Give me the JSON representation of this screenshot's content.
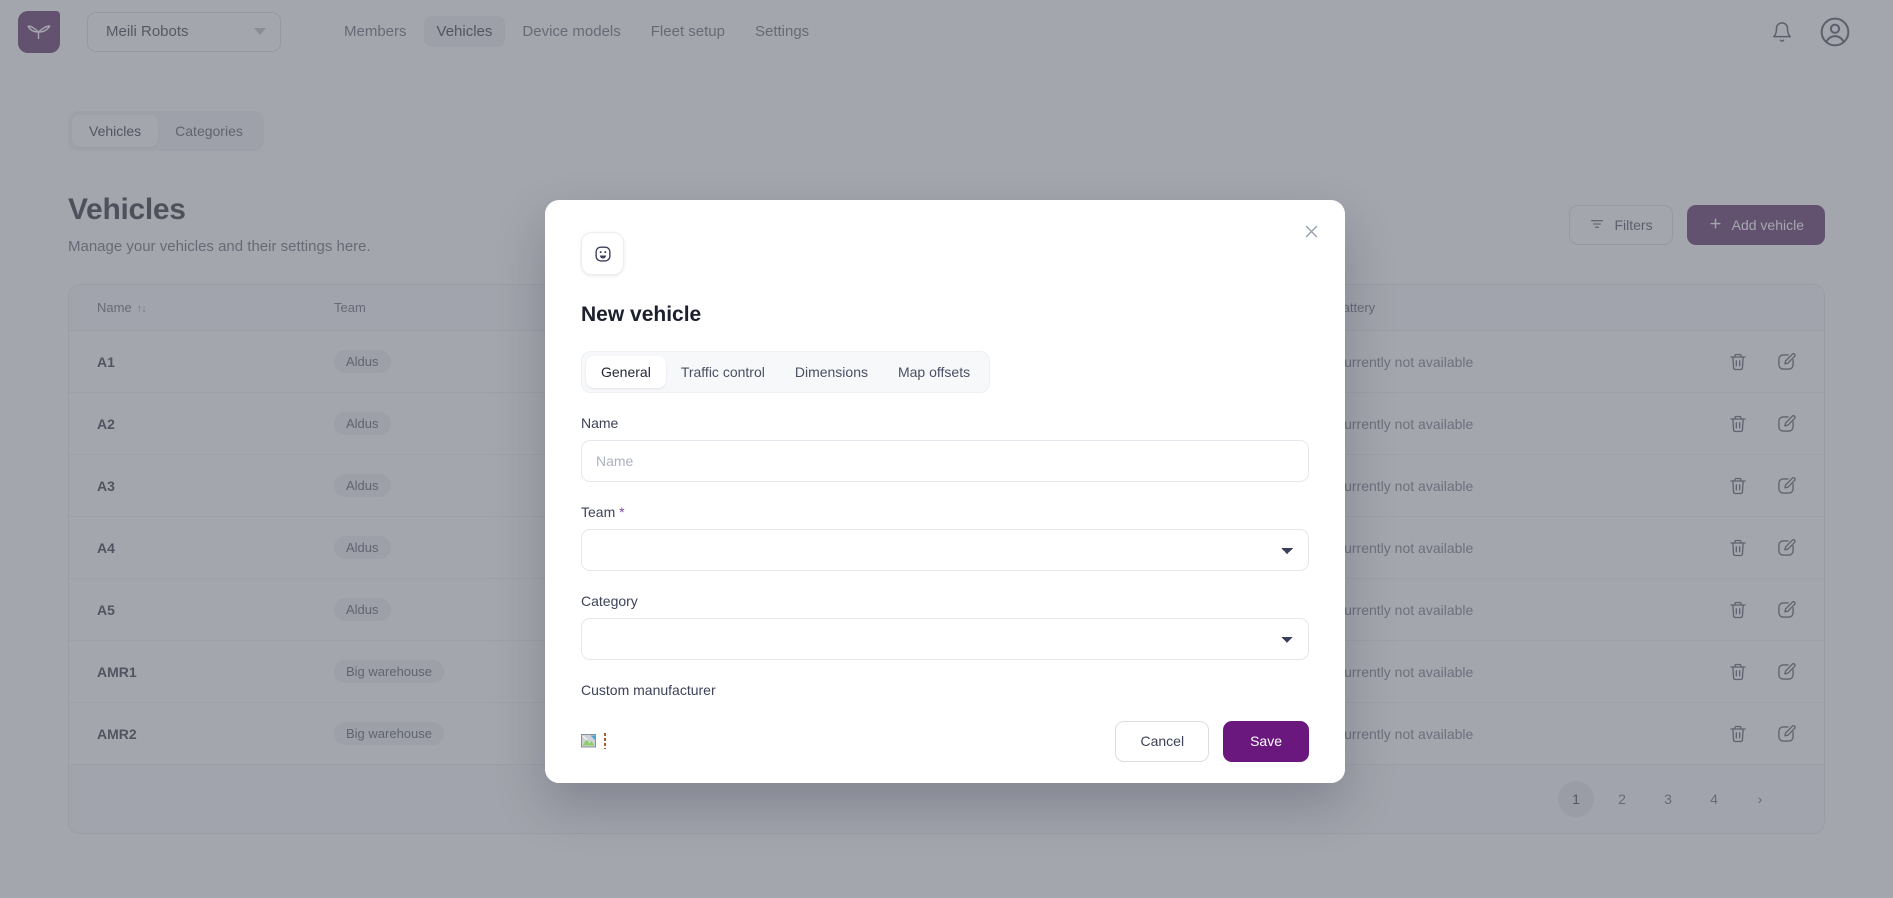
{
  "topnav": {
    "logo_icon": "meili-logo-icon",
    "org": {
      "label": "Meili Robots",
      "caret_icon": "caret-down-icon"
    },
    "links": [
      {
        "label": "Members",
        "active": false
      },
      {
        "label": "Vehicles",
        "active": true
      },
      {
        "label": "Device models",
        "active": false
      },
      {
        "label": "Fleet setup",
        "active": false
      },
      {
        "label": "Settings",
        "active": false
      }
    ],
    "notifications_icon": "bell-icon",
    "account_icon": "user-avatar-icon"
  },
  "section_tabs": [
    {
      "label": "Vehicles",
      "active": true
    },
    {
      "label": "Categories",
      "active": false
    }
  ],
  "page": {
    "title": "Vehicles",
    "subtitle": "Manage your vehicles and their settings here."
  },
  "actions": {
    "filters_label": "Filters",
    "filters_icon": "filter-icon",
    "add_label": "Add vehicle",
    "add_icon": "plus-icon"
  },
  "table": {
    "columns": {
      "name": "Name",
      "name_sort": "↑↓",
      "team": "Team",
      "battery": "Battery"
    },
    "rows": [
      {
        "name": "A1",
        "team": "Aldus",
        "battery": "Currently not available"
      },
      {
        "name": "A2",
        "team": "Aldus",
        "battery": "Currently not available"
      },
      {
        "name": "A3",
        "team": "Aldus",
        "battery": "Currently not available"
      },
      {
        "name": "A4",
        "team": "Aldus",
        "battery": "Currently not available"
      },
      {
        "name": "A5",
        "team": "Aldus",
        "battery": "Currently not available"
      },
      {
        "name": "AMR1",
        "team": "Big warehouse",
        "battery": "Currently not available"
      },
      {
        "name": "AMR2",
        "team": "Big warehouse",
        "battery": "Currently not available"
      }
    ],
    "row_actions": {
      "delete_icon": "trash-icon",
      "edit_icon": "edit-pencil-icon"
    }
  },
  "pagination": {
    "pages": [
      "1",
      "2",
      "3",
      "4"
    ],
    "current": "1",
    "next_label": "›"
  },
  "modal": {
    "emblem_icon": "robot-face-icon",
    "close_icon": "close-icon",
    "title": "New vehicle",
    "tabs": [
      {
        "label": "General",
        "active": true
      },
      {
        "label": "Traffic control",
        "active": false
      },
      {
        "label": "Dimensions",
        "active": false
      },
      {
        "label": "Map offsets",
        "active": false
      }
    ],
    "fields": {
      "name": {
        "label": "Name",
        "placeholder": "Name",
        "value": ""
      },
      "team": {
        "label": "Team",
        "required": "*",
        "value": ""
      },
      "category": {
        "label": "Category",
        "value": ""
      },
      "custom_manufacturer": {
        "label": "Custom manufacturer"
      }
    },
    "footer": {
      "broken_image_icon": "broken-image-icon",
      "cancel_label": "Cancel",
      "save_label": "Save"
    }
  },
  "colors": {
    "brand_purple": "#6b187e",
    "text_dark": "#1c1f2e",
    "text_muted": "#5d6275"
  }
}
